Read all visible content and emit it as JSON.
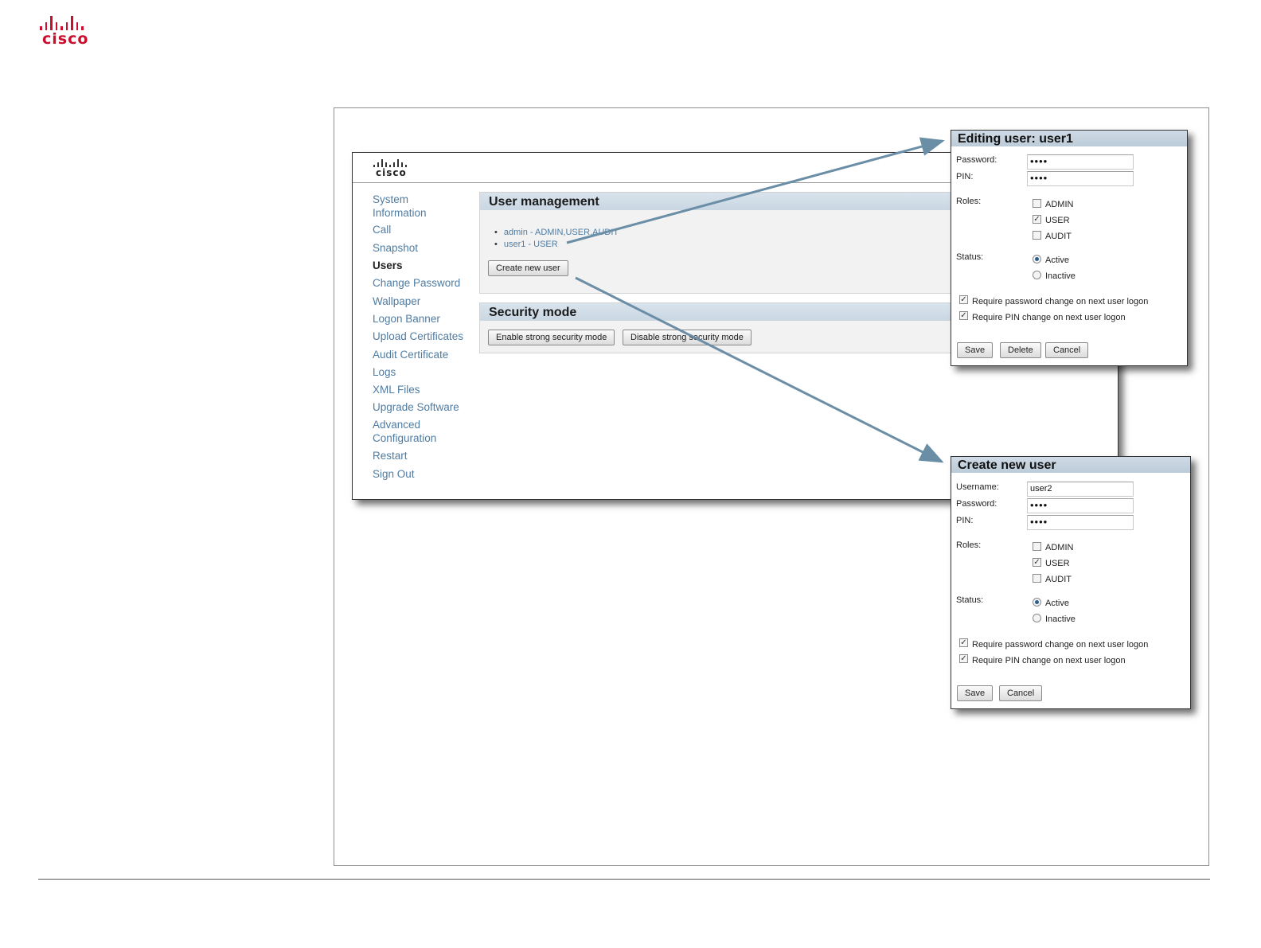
{
  "brand": {
    "name": "cisco"
  },
  "app": {
    "brand": "cisco",
    "nav": [
      {
        "label": "System"
      },
      {
        "label": "Information"
      },
      {
        "label": "Call"
      },
      {
        "label": "Snapshot"
      },
      {
        "label": "Users",
        "active": true
      },
      {
        "label": "Change Password"
      },
      {
        "label": "Wallpaper"
      },
      {
        "label": "Logon Banner"
      },
      {
        "label": "Upload Certificates"
      },
      {
        "label": "Audit Certificate"
      },
      {
        "label": "Logs"
      },
      {
        "label": "XML Files"
      },
      {
        "label": "Upgrade Software"
      },
      {
        "label": "Advanced"
      },
      {
        "label": "Configuration"
      },
      {
        "label": "Restart"
      },
      {
        "label": "Sign Out"
      }
    ],
    "user_management": {
      "title": "User management",
      "users": [
        {
          "label": "admin - ADMIN,USER,AUDIT"
        },
        {
          "label": "user1 - USER"
        }
      ],
      "create_button": "Create new user"
    },
    "security_mode": {
      "title": "Security mode",
      "enable_button": "Enable strong security mode",
      "disable_button": "Disable strong security mode"
    }
  },
  "edit_dialog": {
    "title": "Editing user: user1",
    "password_label": "Password:",
    "password_value": "••••",
    "pin_label": "PIN:",
    "pin_value": "••••",
    "roles_label": "Roles:",
    "roles": [
      {
        "label": "ADMIN",
        "checked": false
      },
      {
        "label": "USER",
        "checked": true
      },
      {
        "label": "AUDIT",
        "checked": false
      }
    ],
    "status_label": "Status:",
    "status_options": [
      {
        "label": "Active",
        "selected": true
      },
      {
        "label": "Inactive",
        "selected": false
      }
    ],
    "require_password_change": {
      "label": "Require password change on next user logon",
      "checked": true
    },
    "require_pin_change": {
      "label": "Require PIN change on next user logon",
      "checked": true
    },
    "save_button": "Save",
    "delete_button": "Delete",
    "cancel_button": "Cancel"
  },
  "create_dialog": {
    "title": "Create new user",
    "username_label": "Username:",
    "username_value": "user2",
    "password_label": "Password:",
    "password_value": "••••",
    "pin_label": "PIN:",
    "pin_value": "••••",
    "roles_label": "Roles:",
    "roles": [
      {
        "label": "ADMIN",
        "checked": false
      },
      {
        "label": "USER",
        "checked": true
      },
      {
        "label": "AUDIT",
        "checked": false
      }
    ],
    "status_label": "Status:",
    "status_options": [
      {
        "label": "Active",
        "selected": true
      },
      {
        "label": "Inactive",
        "selected": false
      }
    ],
    "require_password_change": {
      "label": "Require password change on next user logon",
      "checked": true
    },
    "require_pin_change": {
      "label": "Require PIN change on next user logon",
      "checked": true
    },
    "save_button": "Save",
    "cancel_button": "Cancel"
  },
  "colors": {
    "arrow": "#6b8ea7",
    "logo": "#c8102e",
    "link": "#4f7ca3"
  }
}
